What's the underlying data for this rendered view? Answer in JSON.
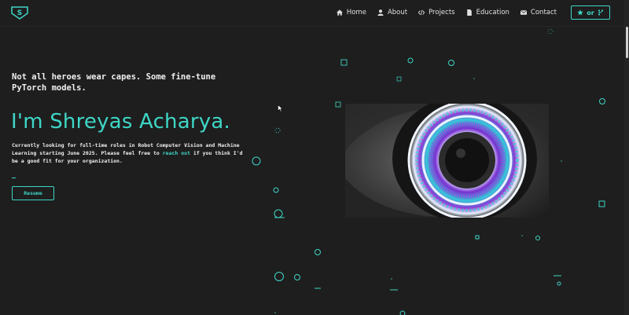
{
  "navbar": {
    "logo_letter": "S",
    "links": [
      {
        "label": "Home",
        "icon": "home-icon"
      },
      {
        "label": "About",
        "icon": "user-icon"
      },
      {
        "label": "Projects",
        "icon": "code-icon"
      },
      {
        "label": "Education",
        "icon": "file-icon"
      },
      {
        "label": "Contact",
        "icon": "envelope-icon"
      }
    ],
    "star_button": {
      "label": "or",
      "icons": [
        "star-icon",
        "fork-icon"
      ]
    }
  },
  "hero": {
    "tagline": "Not all heroes wear capes. Some fine-tune PyTorch models.",
    "name": "I'm Shreyas Acharya.",
    "intro_before": "Currently looking for full-time roles in Robot Computer Vision and Machine Learning starting June 2025. Please feel free to ",
    "intro_link": "reach out",
    "intro_after": " if you think I'd be a good fit for your organization.",
    "resume_label": "Resume"
  },
  "colors": {
    "accent": "#3ed6c6",
    "background": "#1e1e1e",
    "iris_purple": "#8a3cd6"
  }
}
